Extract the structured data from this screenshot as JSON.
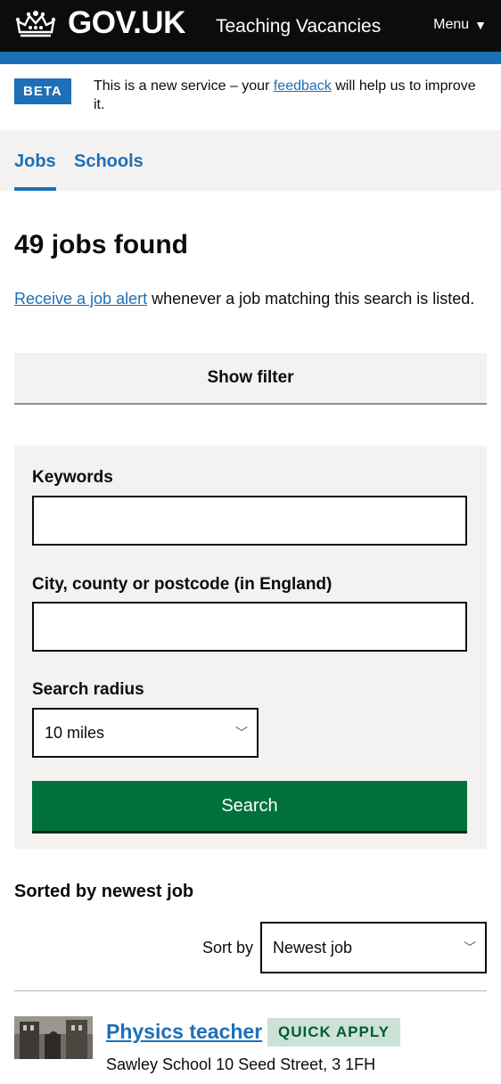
{
  "header": {
    "brand": "GOV.UK",
    "service_name": "Teaching Vacancies",
    "menu_label": "Menu",
    "menu_icon": "triangle-down-icon",
    "crown_icon": "crown-icon"
  },
  "beta_banner": {
    "tag": "BETA",
    "message_before": "This is a new service – your ",
    "link": "feedback",
    "message_after": " will help us to improve it."
  },
  "nav": {
    "tabs": [
      {
        "label": "Jobs",
        "active": true
      },
      {
        "label": "Schools",
        "active": false
      }
    ]
  },
  "results": {
    "heading": "49 jobs found",
    "alert_link": "Receive a job alert",
    "alert_text": " whenever a job matching this search is listed."
  },
  "filter": {
    "toggle_label": "Show filter",
    "keywords_label": "Keywords",
    "keywords_value": "",
    "location_label": "City, county or postcode (in England)",
    "location_value": "",
    "radius_label": "Search radius",
    "radius_value": "10 miles",
    "search_button": "Search"
  },
  "sorting": {
    "heading": "Sorted by newest job",
    "label": "Sort by",
    "value": "Newest job"
  },
  "jobs": [
    {
      "title": "Physics teacher",
      "badge": "QUICK APPLY",
      "address": "Sawley School 10 Seed Street, 3 1FH"
    }
  ],
  "colors": {
    "header_bg": "#0b0c0c",
    "accent_blue": "#1d70b8",
    "button_green": "#00703c",
    "panel_grey": "#f3f2f1",
    "tag_green_bg": "#cce2d8",
    "tag_green_text": "#005a30"
  }
}
